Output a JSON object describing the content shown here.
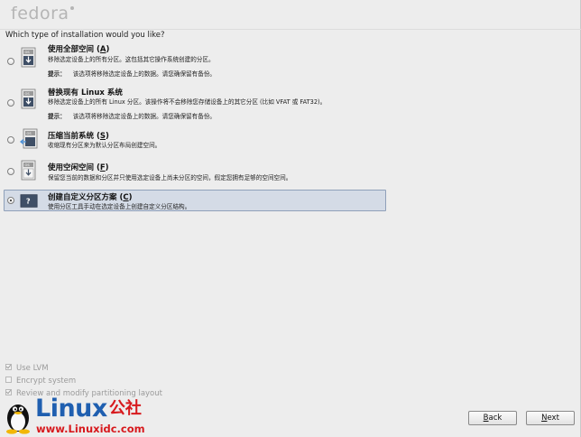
{
  "header": {
    "logo_text": "fedora"
  },
  "question": "Which type of installation would you like?",
  "options": [
    {
      "title_main": "使用全部空间 (",
      "title_key": "A",
      "title_end": ")",
      "desc": "移除选定设备上的所有分区。这包括其它操作系统创建的分区。",
      "tip_label": "提示：",
      "tip_text": "该选项将移除选定设备上的数据。请您确保留有备份。",
      "selected": false
    },
    {
      "title_main": "替换现有 Linux 系统",
      "title_key": "",
      "title_end": "",
      "desc": "移除选定设备上的所有 Linux 分区。该操作将不会移除您存储设备上的其它分区 (比如 VFAT 或 FAT32)。",
      "tip_label": "提示：",
      "tip_text": "该选项将移除选定设备上的数据。请您确保留有备份。",
      "selected": false
    },
    {
      "title_main": "压缩当前系统 (",
      "title_key": "S",
      "title_end": ")",
      "desc": "收缩现有分区来为默认分区布局创建空间。",
      "tip_label": "",
      "tip_text": "",
      "selected": false
    },
    {
      "title_main": "使用空闲空间 (",
      "title_key": "F",
      "title_end": ")",
      "desc": "保留您当前的数据和分区并只使用选定设备上尚未分区的空间，假定您拥有足够的空间空间。",
      "tip_label": "",
      "tip_text": "",
      "selected": false
    },
    {
      "title_main": "创建自定义分区方案 (",
      "title_key": "C",
      "title_end": ")",
      "desc": "使用分区工具手动在选定设备上创建自定义分区结构。",
      "tip_label": "",
      "tip_text": "",
      "selected": true
    }
  ],
  "checkboxes": [
    {
      "label": "Use LVM",
      "checked": true
    },
    {
      "label": "Encrypt system",
      "checked": false
    },
    {
      "label": "Review and modify partitioning layout",
      "checked": true
    }
  ],
  "buttons": {
    "back_prefix": "",
    "back_key": "B",
    "back_rest": "ack",
    "next_prefix": "",
    "next_key": "N",
    "next_rest": "ext"
  },
  "watermark": {
    "title": "Linux",
    "title_cn": "公社",
    "site": "www.Linuxidc.com"
  },
  "colors": {
    "selected_bg": "#d4dbe6",
    "selected_border": "#8fa0ba",
    "window_bg": "#ededed",
    "watermark_blue": "#1f5fb0",
    "watermark_red": "#d7191d"
  }
}
